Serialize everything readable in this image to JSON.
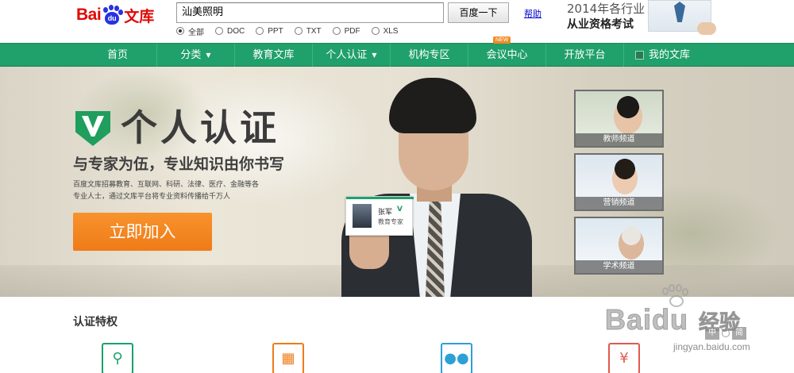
{
  "header": {
    "logo": {
      "bai": "Bai",
      "du": "du",
      "wenku": "文库"
    },
    "search": {
      "value": "汕美照明",
      "button_label": "百度一下",
      "help_label": "帮助"
    },
    "filetypes": [
      {
        "label": "全部",
        "selected": true
      },
      {
        "label": "DOC",
        "selected": false
      },
      {
        "label": "PPT",
        "selected": false
      },
      {
        "label": "TXT",
        "selected": false
      },
      {
        "label": "PDF",
        "selected": false
      },
      {
        "label": "XLS",
        "selected": false
      }
    ],
    "ad": {
      "line1": "2014年各行业",
      "line2": "从业资格考试"
    }
  },
  "nav": {
    "items": [
      {
        "label": "首页"
      },
      {
        "label": "分类",
        "caret": "▼"
      },
      {
        "label": "教育文库"
      },
      {
        "label": "个人认证",
        "caret": "▼"
      },
      {
        "label": "机构专区"
      },
      {
        "label": "会议中心",
        "badge": "NEW"
      },
      {
        "label": "开放平台"
      },
      {
        "label": "我的文库",
        "icon": "user-icon"
      }
    ]
  },
  "banner": {
    "title": "个人认证",
    "subtitle": "与专家为伍，专业知识由你书写",
    "desc_line1": "百度文库招募教育、互联网、科研、法律、医疗、金融等各",
    "desc_line2": "专业人士，通过文库平台将专业资料传播给千万人",
    "join_label": "立即加入",
    "card": {
      "name": "张军",
      "verified_mark": "V",
      "title": "教育专家"
    },
    "channels": [
      {
        "label": "教师频道"
      },
      {
        "label": "营销频道"
      },
      {
        "label": "学术频道"
      }
    ]
  },
  "features": {
    "title": "认证特权",
    "icons": [
      "search-icon",
      "calendar-icon",
      "chat-icon",
      "money-icon"
    ]
  },
  "watermark": {
    "brand": "Baidu",
    "cn": "经验",
    "url": "jingyan.baidu.com",
    "lang": [
      "中",
      "简"
    ]
  },
  "colors": {
    "brand_red": "#e10602",
    "brand_blue": "#2932e1",
    "nav_green": "#20a06a",
    "join_orange": "#ef7b17",
    "badge_orange": "#f08a24"
  }
}
